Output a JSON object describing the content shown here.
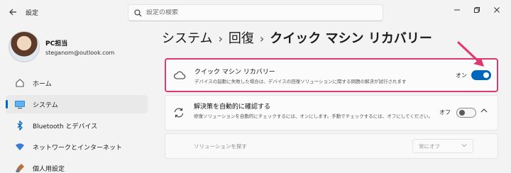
{
  "titlebar": {
    "app_title": "設定",
    "search_placeholder": "設定の検索"
  },
  "profile": {
    "name": "PC担当",
    "email": "steganom@outlook.com"
  },
  "sidebar": {
    "items": [
      {
        "label": "ホーム",
        "icon": "home-icon"
      },
      {
        "label": "システム",
        "icon": "system-icon",
        "active": true
      },
      {
        "label": "Bluetooth とデバイス",
        "icon": "bluetooth-icon"
      },
      {
        "label": "ネットワークとインターネット",
        "icon": "network-icon"
      },
      {
        "label": "個人用設定",
        "icon": "personalization-icon"
      }
    ]
  },
  "breadcrumb": {
    "level1": "システム",
    "level2": "回復",
    "current": "クイック マシン リカバリー"
  },
  "cards": {
    "quick_recovery": {
      "title": "クイック マシン リカバリー",
      "description": "デバイスの起動に失敗した場合は、デバイスの回復ソリューションに関する問題の解決が試行されます",
      "state_label": "オン",
      "enabled": true
    },
    "auto_check": {
      "title": "解決策を自動的に確認する",
      "description": "修復ソリューションを自動的にチェックするには、オンにします。手動でチェックするには、オフにしてください。",
      "state_label": "オフ",
      "enabled": false
    },
    "search_solutions": {
      "label": "ソリューションを探す",
      "select_value": "常にオフ"
    }
  },
  "colors": {
    "accent": "#0067c0",
    "highlight": "#e0386e"
  }
}
